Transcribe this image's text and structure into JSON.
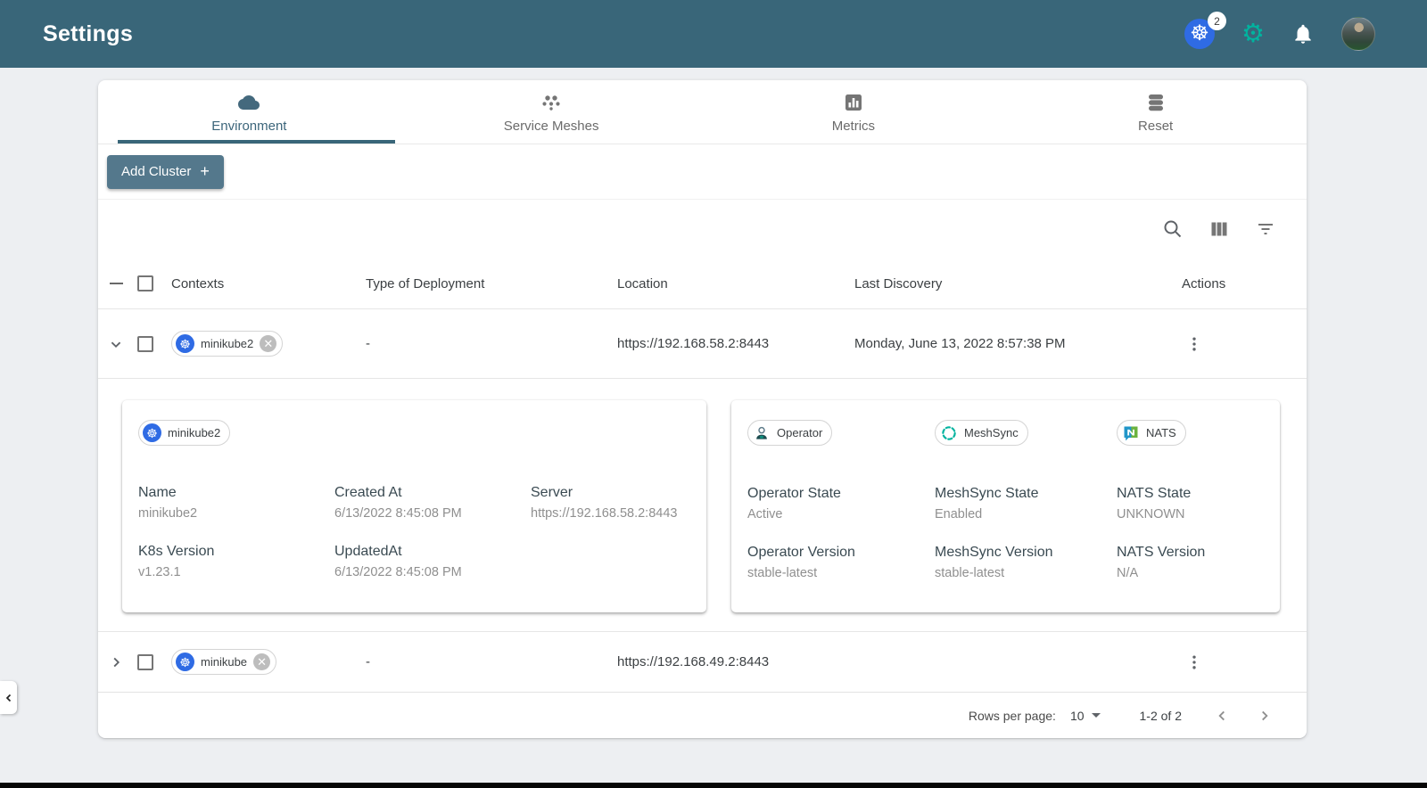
{
  "header": {
    "title": "Settings",
    "context_badge": "2",
    "colors": {
      "bg": "#396679",
      "gear_green": "#00B39F",
      "kubernetes_blue": "#2F6BE4",
      "accent": "#396679"
    }
  },
  "tabs": [
    {
      "label": "Environment",
      "icon": "cloud-icon",
      "active": true
    },
    {
      "label": "Service Meshes",
      "icon": "mesh-icon",
      "active": false
    },
    {
      "label": "Metrics",
      "icon": "bar-chart-icon",
      "active": false
    },
    {
      "label": "Reset",
      "icon": "database-icon",
      "active": false
    }
  ],
  "actions_bar": {
    "add_cluster_label": "Add Cluster",
    "add_cluster_plus": "+"
  },
  "table": {
    "columns": [
      "Contexts",
      "Type of Deployment",
      "Location",
      "Last Discovery",
      "Actions"
    ],
    "rows": [
      {
        "context": "minikube2",
        "type_of_deployment": "-",
        "location": "https://192.168.58.2:8443",
        "last_discovery": "Monday, June 13, 2022 8:57:38 PM"
      },
      {
        "context": "minikube",
        "type_of_deployment": "-",
        "location": "https://192.168.49.2:8443",
        "last_discovery": ""
      }
    ]
  },
  "detail_panel": {
    "cluster_chip": "minikube2",
    "cluster_fields": [
      {
        "label": "Name",
        "value": "minikube2"
      },
      {
        "label": "Created At",
        "value": "6/13/2022 8:45:08 PM"
      },
      {
        "label": "Server",
        "value": "https://192.168.58.2:8443"
      },
      {
        "label": "K8s Version",
        "value": "v1.23.1"
      },
      {
        "label": "UpdatedAt",
        "value": "6/13/2022 8:45:08 PM"
      }
    ],
    "operator_chips": [
      {
        "label": "Operator"
      },
      {
        "label": "MeshSync"
      },
      {
        "label": "NATS"
      }
    ],
    "operator_fields": [
      {
        "label": "Operator State",
        "value": "Active"
      },
      {
        "label": "MeshSync State",
        "value": "Enabled"
      },
      {
        "label": "NATS State",
        "value": "UNKNOWN"
      },
      {
        "label": "Operator Version",
        "value": "stable-latest"
      },
      {
        "label": "MeshSync Version",
        "value": "stable-latest"
      },
      {
        "label": "NATS Version",
        "value": "N/A"
      }
    ]
  },
  "pagination": {
    "rows_per_page_label": "Rows per page:",
    "rows_per_page_value": "10",
    "range_text": "1-2 of 2"
  }
}
